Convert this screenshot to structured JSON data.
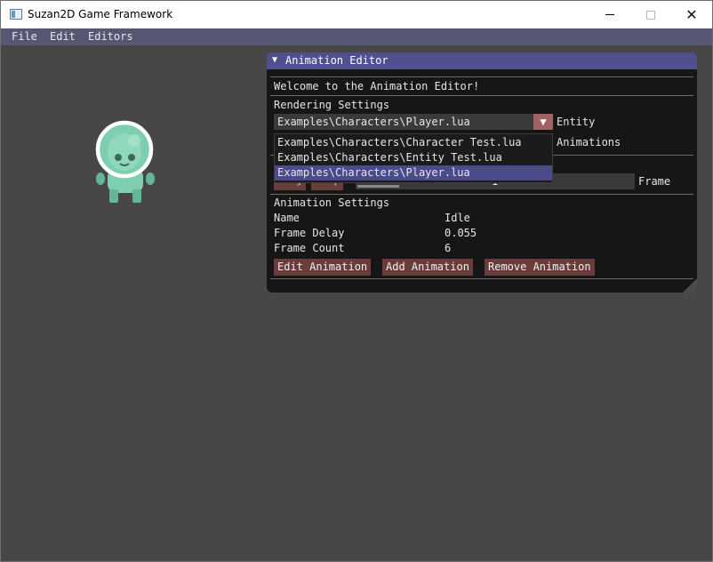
{
  "window": {
    "title": "Suzan2D Game Framework",
    "close_glyph": "✕"
  },
  "menubar": {
    "items": [
      "File",
      "Edit",
      "Editors"
    ]
  },
  "panel": {
    "title": "Animation Editor",
    "welcome": "Welcome to the Animation Editor!",
    "rendering_heading": "Rendering Settings",
    "combo": {
      "selected": "Examples\\Characters\\Player.lua",
      "options": [
        "Examples\\Characters\\Character Test.lua",
        "Examples\\Characters\\Entity Test.lua",
        "Examples\\Characters\\Player.lua"
      ]
    },
    "entity_label": "Entity",
    "animations_label": "Animations",
    "play_label": "Play",
    "stop_label": "Stop",
    "frame_value": "1",
    "frame_label": "Frame",
    "frame_progress": 0.15,
    "animation_heading": "Animation Settings",
    "settings": [
      {
        "label": "Name",
        "value": "Idle"
      },
      {
        "label": "Frame Delay",
        "value": "0.055"
      },
      {
        "label": "Frame Count",
        "value": "6"
      }
    ],
    "buttons": {
      "edit": "Edit Animation",
      "add": "Add Animation",
      "remove": "Remove Animation"
    }
  },
  "colors": {
    "menubar": "#575773",
    "panel_title": "#51508f",
    "button": "#6b3c3c",
    "selected_item": "#4b4a8a",
    "character": "#7dcfb0"
  },
  "icons": {
    "collapse": "triangle-down-icon",
    "combo_arrow": "triangle-down-icon",
    "window_close": "close-icon"
  }
}
